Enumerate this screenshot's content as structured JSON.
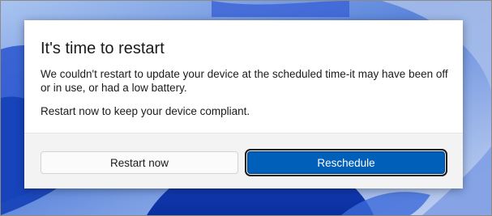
{
  "dialog": {
    "title": "It's time to restart",
    "message": "We couldn't restart to update your device at the scheduled time-it may have been off or in use, or had a low battery.",
    "message_secondary": "Restart now to keep your device compliant."
  },
  "buttons": {
    "restart_now_label": "Restart now",
    "reschedule_label": "Reschedule"
  },
  "colors": {
    "accent": "#005fb8",
    "dialog_background": "#ffffff",
    "footer_background": "#f3f3f3",
    "wallpaper_base": "#1f4fd0"
  }
}
